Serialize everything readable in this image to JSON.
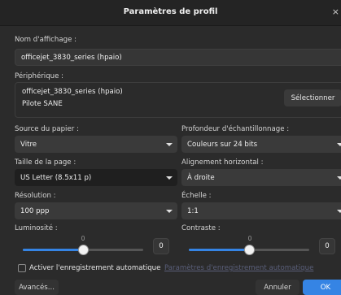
{
  "window": {
    "title": "Paramètres de profil",
    "close_glyph": "×"
  },
  "display_name": {
    "label": "Nom d'affichage :",
    "value": "officejet_3830_series (hpaio)"
  },
  "device": {
    "label": "Périphérique :",
    "name": "officejet_3830_series (hpaio)",
    "backend": "Pilote SANE",
    "select_label": "Sélectionner"
  },
  "paper_source": {
    "label": "Source du papier :",
    "value": "Vitre"
  },
  "depth": {
    "label": "Profondeur d'échantillonnage :",
    "value": "Couleurs sur 24 bits"
  },
  "page_size": {
    "label": "Taille de la page :",
    "value": "US Letter (8.5x11 p)"
  },
  "h_align": {
    "label": "Alignement horizontal :",
    "value": "À droite"
  },
  "resolution": {
    "label": "Résolution :",
    "value": "100 ppp"
  },
  "scale": {
    "label": "Échelle :",
    "value": "1:1"
  },
  "brightness": {
    "label": "Luminosité :",
    "slider_label": "0",
    "value": "0",
    "level_fraction": 0.5
  },
  "contrast": {
    "label": "Contraste :",
    "slider_label": "0",
    "value": "0",
    "level_fraction": 0.5
  },
  "autosave": {
    "checkbox_label": "Activer l'enregistrement automatique",
    "settings_link": "Paramètres d'enregistrement automatique",
    "checked": false
  },
  "footer": {
    "advanced_label": "Avancés...",
    "cancel_label": "Annuler",
    "ok_label": "OK"
  },
  "colors": {
    "accent": "#3584e4",
    "background": "#2b2b2b",
    "titlebar": "#242424"
  }
}
